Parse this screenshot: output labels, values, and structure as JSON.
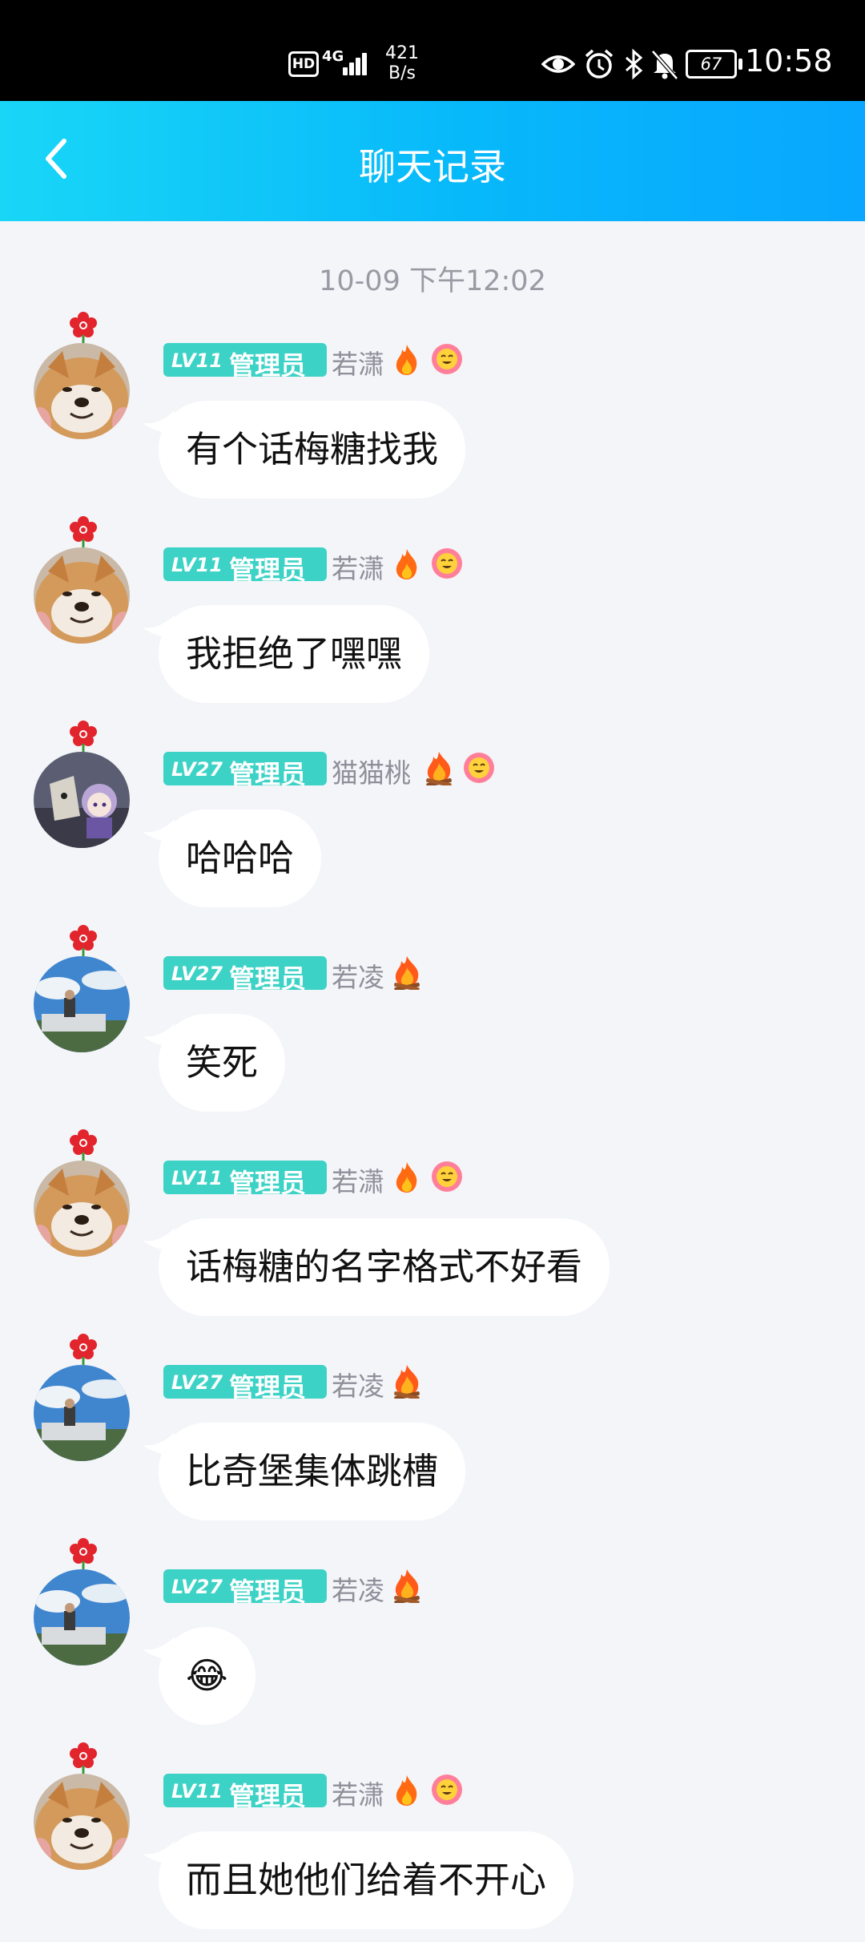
{
  "status_bar": {
    "hd": "HD",
    "network": "4G",
    "speed_value": "421",
    "speed_unit": "B/s",
    "battery": "67",
    "time": "10:58"
  },
  "header": {
    "title": "聊天记录",
    "back_icon": "chevron-left-icon"
  },
  "timestamp": "10-09 下午12:02",
  "colors": {
    "header_start": "#19d6f7",
    "header_end": "#09a7ff",
    "badge": "#3dd2c6",
    "background": "#f4f5f9",
    "nick": "#8e8f99"
  },
  "messages": [
    {
      "level": "LV11",
      "role": "管理员",
      "nick": "若潇",
      "text": "有个话梅糖找我",
      "icons": [
        "fire",
        "smiley-flower"
      ]
    },
    {
      "level": "LV11",
      "role": "管理员",
      "nick": "若潇",
      "text": "我拒绝了嘿嘿",
      "icons": [
        "fire",
        "smiley-flower"
      ]
    },
    {
      "level": "LV27",
      "role": "管理员",
      "nick": "猫猫桃",
      "text": "哈哈哈",
      "icons": [
        "bonfire",
        "smiley-flower"
      ]
    },
    {
      "level": "LV27",
      "role": "管理员",
      "nick": "若凌",
      "text": "笑死",
      "icons": [
        "bonfire"
      ]
    },
    {
      "level": "LV11",
      "role": "管理员",
      "nick": "若潇",
      "text": "话梅糖的名字格式不好看",
      "icons": [
        "fire",
        "smiley-flower"
      ]
    },
    {
      "level": "LV27",
      "role": "管理员",
      "nick": "若凌",
      "text": "比奇堡集体跳槽",
      "icons": [
        "bonfire"
      ]
    },
    {
      "level": "LV27",
      "role": "管理员",
      "nick": "若凌",
      "text": "😂",
      "icons": [
        "bonfire"
      ]
    },
    {
      "level": "LV11",
      "role": "管理员",
      "nick": "若潇",
      "text": "而且她他们给着不开心",
      "icons": [
        "fire",
        "smiley-flower"
      ]
    }
  ]
}
